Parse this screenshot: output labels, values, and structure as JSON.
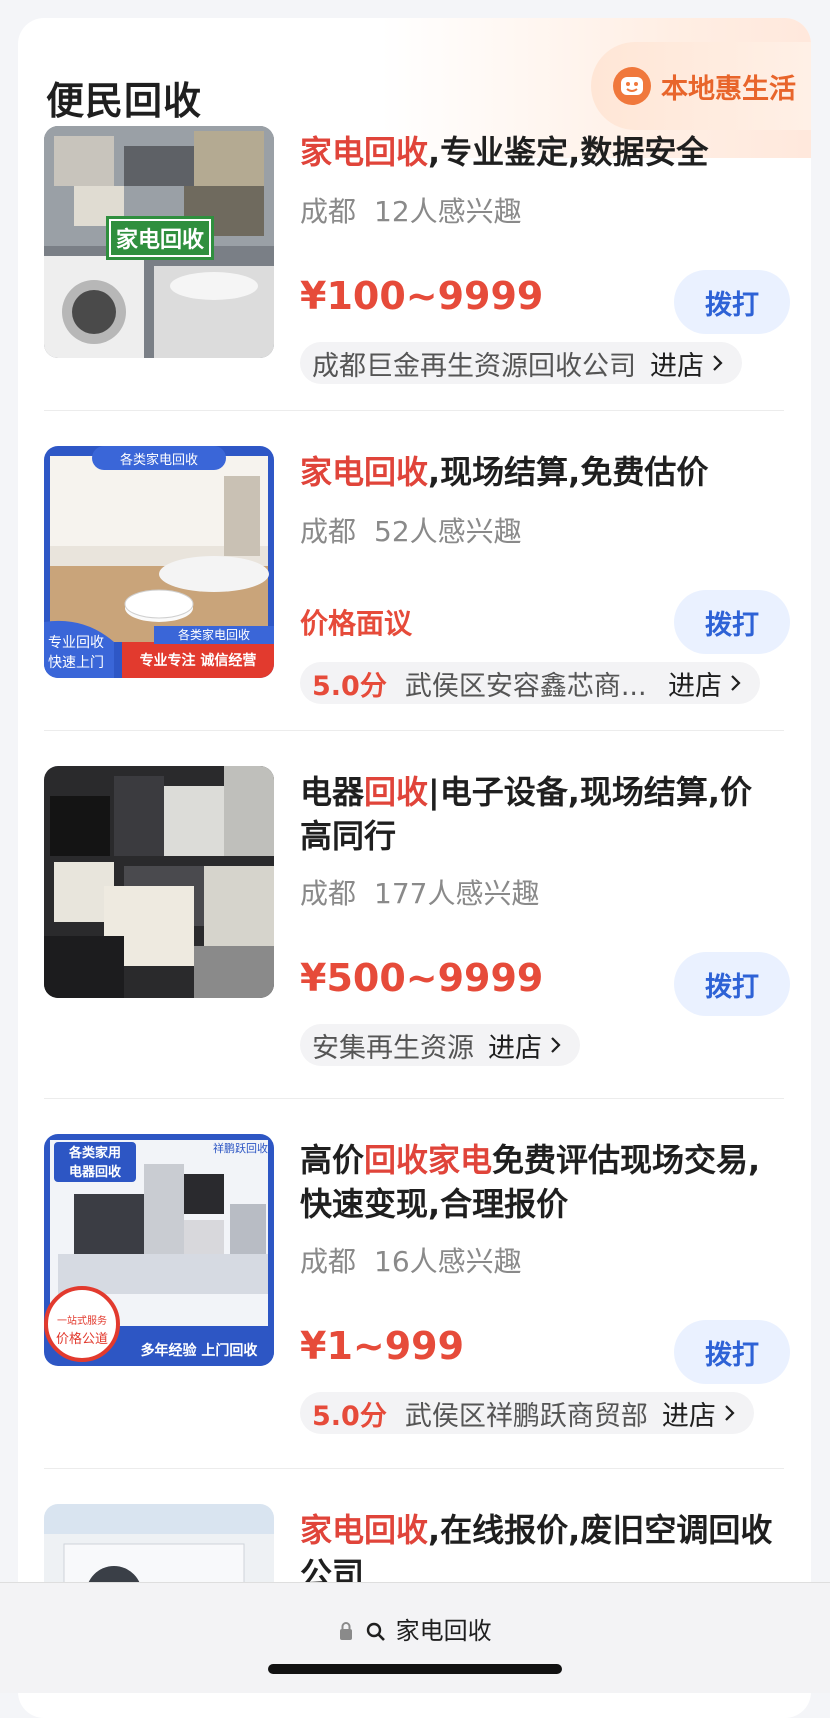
{
  "section": {
    "title": "便民回收",
    "badge": "本地惠生活"
  },
  "items": [
    {
      "title_hl1": "家电回收",
      "title_rest": ",专业鉴定,数据安全",
      "location": "成都",
      "interest": "12人感兴趣",
      "price": "¥100~9999",
      "call": "拨打",
      "score": "",
      "store": "成都巨金再生资源回收公司",
      "enter": "进店",
      "thumb_label": "家电回收"
    },
    {
      "title_hl1": "家电回收",
      "title_rest": ",现场结算,免费估价",
      "location": "成都",
      "interest": "52人感兴趣",
      "price": "价格面议",
      "call": "拨打",
      "score": "5.0分",
      "store": "武侯区安容鑫芯商...",
      "enter": "进店",
      "thumb_top": "各类家电回收",
      "thumb_left1": "专业回收",
      "thumb_left2": "快速上门",
      "thumb_right_top": "各类家电回收",
      "thumb_right": "专业专注 诚信经营"
    },
    {
      "title_pre": "电器",
      "title_hl1": "回收",
      "title_rest": "|电子设备,现场结算,价高同行",
      "location": "成都",
      "interest": "177人感兴趣",
      "price": "¥500~9999",
      "call": "拨打",
      "score": "",
      "store": "安集再生资源",
      "enter": "进店"
    },
    {
      "title_pre": "高价",
      "title_hl1": "回收家电",
      "title_rest": "免费评估现场交易,快速变现,合理报价",
      "location": "成都",
      "interest": "16人感兴趣",
      "price": "¥1~999",
      "call": "拨打",
      "score": "5.0分",
      "store": "武侯区祥鹏跃商贸部",
      "enter": "进店",
      "thumb_tl1": "各类家用",
      "thumb_tl2": "电器回收",
      "thumb_tr": "祥鹏跃回收",
      "thumb_circle1": "一站式服务",
      "thumb_circle2": "价格公道",
      "thumb_bottom": "多年经验 上门回收"
    },
    {
      "title_hl1": "家电回收",
      "title_rest": ",在线报价,废旧空调回收公司"
    }
  ],
  "address_bar": {
    "text": "家电回收"
  },
  "colors": {
    "accent_red": "#e64b3a",
    "call_blue": "#2e62d6",
    "badge_orange": "#e8652b"
  }
}
